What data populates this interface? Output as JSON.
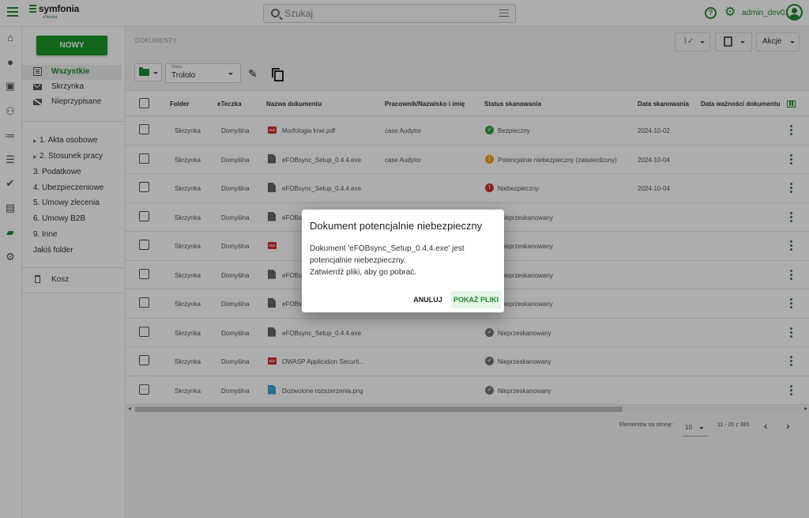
{
  "app": {
    "logo_name": "symfonia",
    "logo_sub": "eTeczka"
  },
  "search": {
    "placeholder": "Szukaj"
  },
  "user": {
    "name": "admin_dev01"
  },
  "colors": {
    "accent": "#1f8a2e",
    "safe": "#2e9e3e",
    "warning": "#f0a020",
    "danger": "#d32f2f",
    "unscanned": "#757575"
  },
  "sidebar": {
    "new_button": "NOWY",
    "items": [
      {
        "label": "Wszystkie",
        "icon": "documents-icon",
        "selected": true
      },
      {
        "label": "Skrzynka",
        "icon": "mail-icon",
        "selected": false
      },
      {
        "label": "Nieprzypisane",
        "icon": "unassigned-mail-icon",
        "selected": false
      }
    ],
    "categories": [
      {
        "label": "1. Akta osobowe",
        "expandable": true
      },
      {
        "label": "2. Stosunek pracy",
        "expandable": true
      },
      {
        "label": "3. Podatkowe",
        "expandable": false
      },
      {
        "label": "4. Ubezpieczeniowe",
        "expandable": false
      },
      {
        "label": "5. Umowy zlecenia",
        "expandable": false
      },
      {
        "label": "6. Umowy B2B",
        "expandable": false
      },
      {
        "label": "9. Inne",
        "expandable": false
      },
      {
        "label": "Jakiś folder",
        "expandable": false
      }
    ],
    "trash": "Kosz"
  },
  "toolbar": {
    "breadcrumb": "DOKUMENTY",
    "actions_label": "Akcje",
    "view_label": "Widok",
    "view_value": "Trololo"
  },
  "table": {
    "headers": {
      "folder": "Folder",
      "eteczka": "eTeczka",
      "name": "Nazwa dokumentu",
      "employee": "Pracownik/Nazwisko i imię",
      "status": "Status skanowania",
      "scan_date": "Data skanowania",
      "expiry": "Data ważności dokumentu"
    },
    "rows": [
      {
        "folder": "Skrzynka",
        "eteczka": "Domyślna",
        "name": "Morfologia krwi.pdf",
        "file_type": "pdf",
        "employee": "case Audytor",
        "status": "Bezpieczny",
        "status_kind": "safe",
        "scan_date": "2024-10-02"
      },
      {
        "folder": "Skrzynka",
        "eteczka": "Domyślna",
        "name": "eFOBsync_Setup_0.4.4.exe",
        "file_type": "file",
        "employee": "case Audytor",
        "status": "Potencjalnie niebezpieczny (zatwierdzony)",
        "status_kind": "warning",
        "scan_date": "2024-10-04"
      },
      {
        "folder": "Skrzynka",
        "eteczka": "Domyślna",
        "name": "eFOBsync_Setup_0.4.4.exe",
        "file_type": "file",
        "employee": "",
        "status": "Niebezpieczny",
        "status_kind": "danger",
        "scan_date": "2024-10-04"
      },
      {
        "folder": "Skrzynka",
        "eteczka": "Domyślna",
        "name": "eFOBs",
        "file_type": "file",
        "employee": "",
        "status": "ieprzeskanowany",
        "status_kind": "hidden",
        "scan_date": ""
      },
      {
        "folder": "Skrzynka",
        "eteczka": "Domyślna",
        "name": "",
        "file_type": "pdf",
        "employee": "",
        "status": "ieprzeskanowany",
        "status_kind": "hidden",
        "scan_date": ""
      },
      {
        "folder": "Skrzynka",
        "eteczka": "Domyślna",
        "name": "eFOBs",
        "file_type": "file",
        "employee": "",
        "status": "ieprzeskanowany",
        "status_kind": "hidden",
        "scan_date": ""
      },
      {
        "folder": "Skrzynka",
        "eteczka": "Domyślna",
        "name": "eFOBs",
        "file_type": "file",
        "employee": "",
        "status": "ieprzeskanowany",
        "status_kind": "hidden",
        "scan_date": ""
      },
      {
        "folder": "Skrzynka",
        "eteczka": "Domyślna",
        "name": "eFOBsync_Setup_0.4.4.exe",
        "file_type": "file",
        "employee": "",
        "status": "Nieprzeskanowany",
        "status_kind": "unscanned",
        "scan_date": ""
      },
      {
        "folder": "Skrzynka",
        "eteczka": "Domyślna",
        "name": "OWASP Application Securit...",
        "file_type": "pdf",
        "employee": "",
        "status": "Nieprzeskanowany",
        "status_kind": "unscanned",
        "scan_date": ""
      },
      {
        "folder": "Skrzynka",
        "eteczka": "Domyślna",
        "name": "Dozwolone rozszerzenia.png",
        "file_type": "image",
        "employee": "",
        "status": "Nieprzeskanowany",
        "status_kind": "unscanned",
        "scan_date": ""
      }
    ]
  },
  "pagination": {
    "per_page_label": "Elementów na stronę :",
    "per_page_value": "10",
    "range": "11 - 20 z 385"
  },
  "dialog": {
    "title": "Dokument potencjalnie niebezpieczny",
    "body_line1": "Dokument 'eFOBsync_Setup_0.4.4.exe' jest",
    "body_line2": "potencjalnie niebezpieczny.",
    "body_line3": "Zatwierdź pliki, aby go pobrać.",
    "cancel": "ANULUJ",
    "confirm": "POKAŻ PLIKI"
  }
}
